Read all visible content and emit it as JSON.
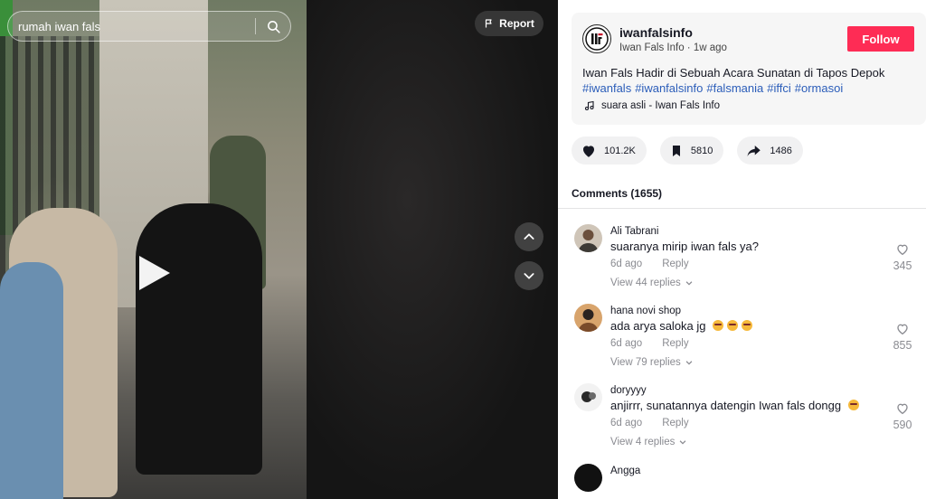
{
  "search": {
    "query": "rumah iwan fals"
  },
  "video": {
    "report_label": "Report"
  },
  "post": {
    "username": "iwanfalsinfo",
    "display_name": "Iwan Fals Info",
    "separator": " · ",
    "posted": "1w ago",
    "follow_label": "Follow",
    "caption": "Iwan Fals Hadir di Sebuah Acara Sunatan di Tapos Depok",
    "hashtags": [
      "#iwanfals",
      "#iwanfalsinfo",
      "#falsmania",
      "#iffci",
      "#ormasoi"
    ],
    "music": "suara asli - Iwan Fals Info"
  },
  "actions": {
    "likes": "101.2K",
    "saves": "5810",
    "shares": "1486"
  },
  "comments_header": "Comments (1655)",
  "comments": [
    {
      "name": "Ali Tabrani",
      "text": "suaranya mirip iwan fals ya?",
      "emoji_count": 0,
      "time": "6d ago",
      "reply_label": "Reply",
      "replies": "View 44 replies",
      "likes": "345",
      "avatar_color": "#6b4f3c"
    },
    {
      "name": "hana novi shop",
      "text": "ada arya saloka jg",
      "emoji_count": 3,
      "time": "6d ago",
      "reply_label": "Reply",
      "replies": "View 79 replies",
      "likes": "855",
      "avatar_color": "#a26b3f"
    },
    {
      "name": "doryyyy",
      "text": "anjirrr, sunatannya datengin Iwan fals dongg",
      "emoji_count": 1,
      "time": "6d ago",
      "reply_label": "Reply",
      "replies": "View 4 replies",
      "likes": "590",
      "avatar_color": "#e8e8e8"
    },
    {
      "name": "Angga",
      "text": "",
      "emoji_count": 0,
      "time": "",
      "reply_label": "",
      "replies": "",
      "likes": "",
      "avatar_color": "#111111"
    }
  ],
  "colors": {
    "follow": "#fe2c55",
    "hashtag": "#2b5db9",
    "muted": "#8a8b91"
  }
}
